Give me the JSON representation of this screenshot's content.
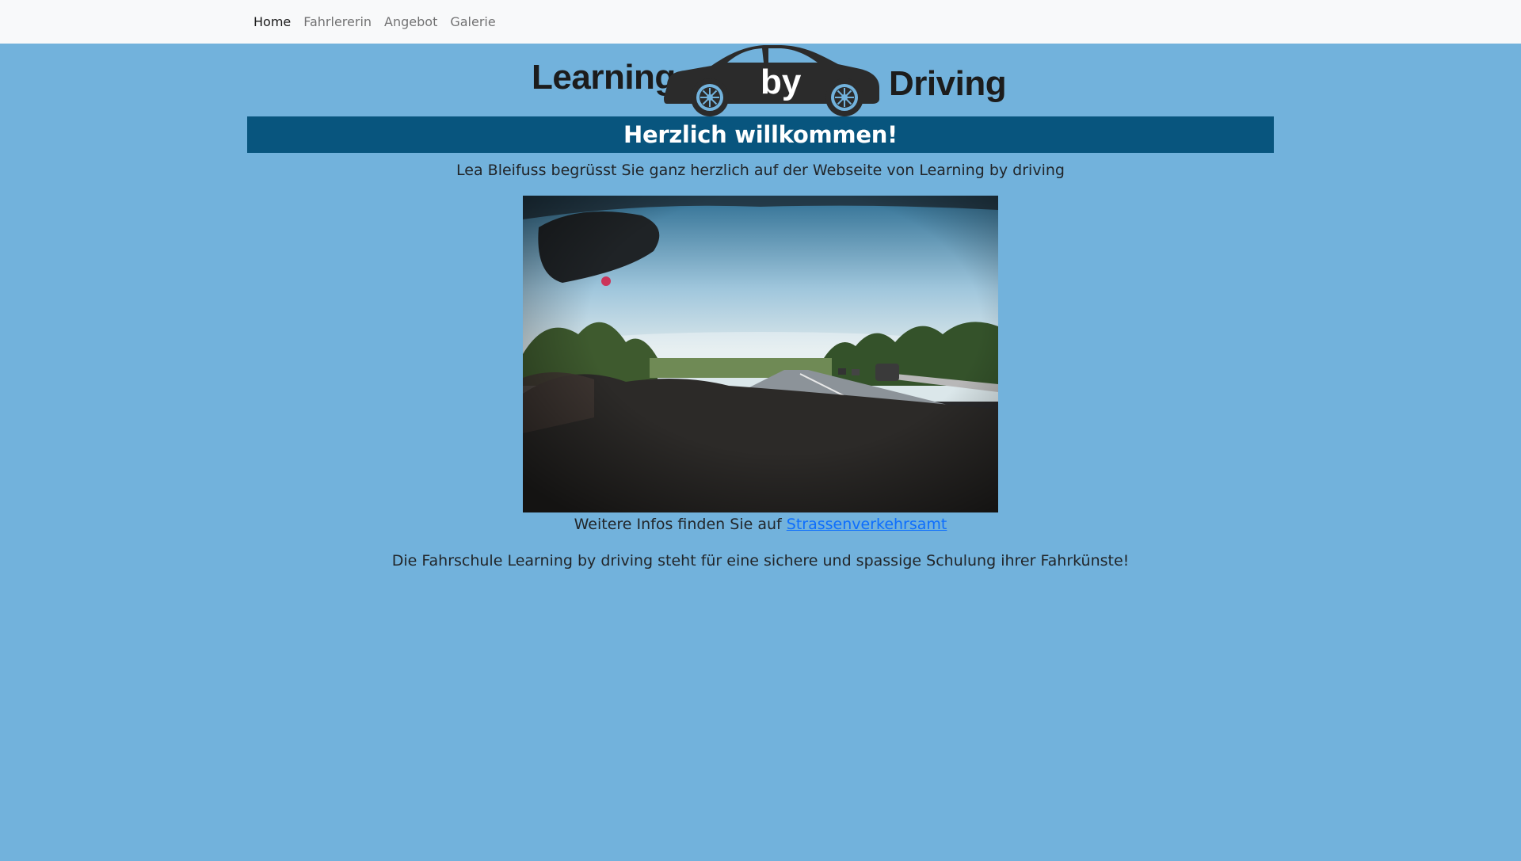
{
  "nav": {
    "items": [
      {
        "label": "Home",
        "active": true
      },
      {
        "label": "Fahrlererin",
        "active": false
      },
      {
        "label": "Angebot",
        "active": false
      },
      {
        "label": "Galerie",
        "active": false
      }
    ]
  },
  "logo": {
    "left_word": "Learning",
    "middle_word": "by",
    "right_word": "Driving",
    "icon": "car-icon"
  },
  "hero": {
    "title": "Herzlich willkommen!",
    "greeting": "Lea Bleifuss begrüsst Sie ganz herzlich auf der Webseite von Learning by driving",
    "photo_icon": "driving-photo"
  },
  "info": {
    "prefix": "Weitere Infos finden Sie auf",
    "link_label": "Strassenverkehrsamt"
  },
  "tagline": "Die Fahrschule Learning by driving steht für eine sichere und spassige Schulung ihrer Fahrkünste!",
  "colors": {
    "page_background": "#72b2dc",
    "navbar_background": "#f8f9fa",
    "welcome_bar": "#08557e",
    "link": "#0d6efd",
    "text": "#212529"
  }
}
